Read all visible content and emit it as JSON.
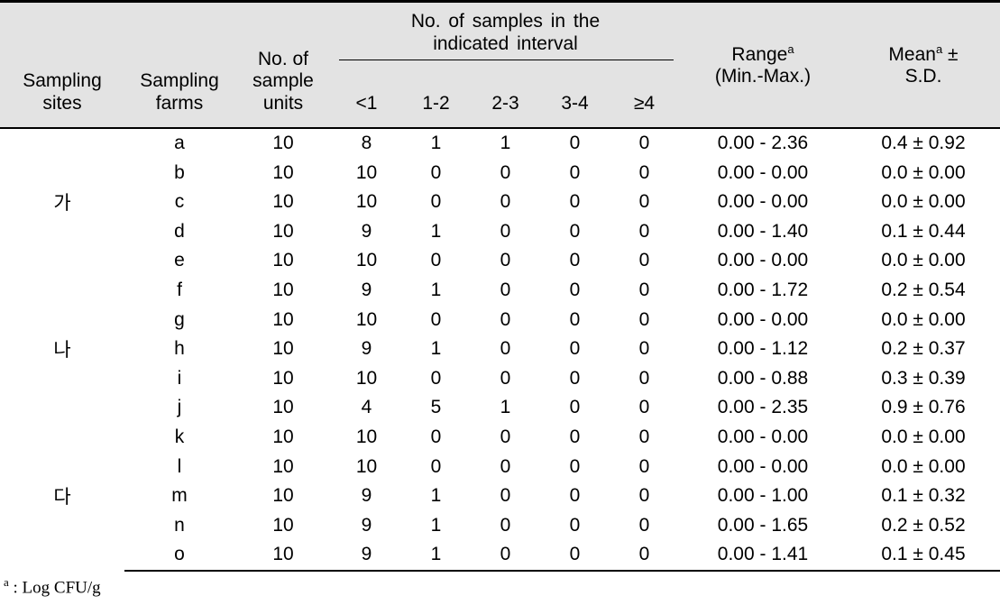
{
  "table": {
    "headers": {
      "sampling_sites": "Sampling\nsites",
      "sampling_sites_l1": "Sampling",
      "sampling_sites_l2": "sites",
      "sampling_farms_l1": "Sampling",
      "sampling_farms_l2": "farms",
      "sample_units_l1": "No. of",
      "sample_units_l2": "sample",
      "sample_units_l3": "units",
      "interval_group_l1": "No. of samples in the",
      "interval_group_l2": "indicated interval",
      "interval_bins": [
        "<1",
        "1-2",
        "2-3",
        "3-4",
        "≥4"
      ],
      "range_l1": "Range",
      "range_sup": "a",
      "range_l2": "(Min.-Max.)",
      "mean_l1": "Mean",
      "mean_sup": "a",
      "mean_pm": "±",
      "mean_l2": "S.D."
    },
    "groups": [
      {
        "site": "가",
        "site_row_index": 2,
        "rows": [
          {
            "farm": "a",
            "units": "10",
            "bins": [
              "8",
              "1",
              "1",
              "0",
              "0"
            ],
            "range": "0.00 - 2.36",
            "mean": "0.4 ± 0.92"
          },
          {
            "farm": "b",
            "units": "10",
            "bins": [
              "10",
              "0",
              "0",
              "0",
              "0"
            ],
            "range": "0.00 - 0.00",
            "mean": "0.0 ± 0.00"
          },
          {
            "farm": "c",
            "units": "10",
            "bins": [
              "10",
              "0",
              "0",
              "0",
              "0"
            ],
            "range": "0.00 - 0.00",
            "mean": "0.0 ± 0.00"
          },
          {
            "farm": "d",
            "units": "10",
            "bins": [
              "9",
              "1",
              "0",
              "0",
              "0"
            ],
            "range": "0.00 - 1.40",
            "mean": "0.1 ± 0.44"
          },
          {
            "farm": "e",
            "units": "10",
            "bins": [
              "10",
              "0",
              "0",
              "0",
              "0"
            ],
            "range": "0.00 - 0.00",
            "mean": "0.0 ± 0.00"
          },
          {
            "farm": "f",
            "units": "10",
            "bins": [
              "9",
              "1",
              "0",
              "0",
              "0"
            ],
            "range": "0.00 - 1.72",
            "mean": "0.2 ± 0.54"
          }
        ]
      },
      {
        "site": "나",
        "site_row_index": 1,
        "rows": [
          {
            "farm": "g",
            "units": "10",
            "bins": [
              "10",
              "0",
              "0",
              "0",
              "0"
            ],
            "range": "0.00 - 0.00",
            "mean": "0.0 ± 0.00"
          },
          {
            "farm": "h",
            "units": "10",
            "bins": [
              "9",
              "1",
              "0",
              "0",
              "0"
            ],
            "range": "0.00 - 1.12",
            "mean": "0.2 ± 0.37"
          },
          {
            "farm": "i",
            "units": "10",
            "bins": [
              "10",
              "0",
              "0",
              "0",
              "0"
            ],
            "range": "0.00 - 0.88",
            "mean": "0.3 ± 0.39"
          },
          {
            "farm": "j",
            "units": "10",
            "bins": [
              "4",
              "5",
              "1",
              "0",
              "0"
            ],
            "range": "0.00 - 2.35",
            "mean": "0.9 ± 0.76"
          },
          {
            "farm": "k",
            "units": "10",
            "bins": [
              "10",
              "0",
              "0",
              "0",
              "0"
            ],
            "range": "0.00 - 0.00",
            "mean": "0.0 ± 0.00"
          },
          {
            "farm": "l",
            "units": "10",
            "bins": [
              "10",
              "0",
              "0",
              "0",
              "0"
            ],
            "range": "0.00 - 0.00",
            "mean": "0.0 ± 0.00"
          }
        ]
      },
      {
        "site": "다",
        "site_row_index": 0,
        "rows": [
          {
            "farm": "m",
            "units": "10",
            "bins": [
              "9",
              "1",
              "0",
              "0",
              "0"
            ],
            "range": "0.00 - 1.00",
            "mean": "0.1 ± 0.32"
          },
          {
            "farm": "n",
            "units": "10",
            "bins": [
              "9",
              "1",
              "0",
              "0",
              "0"
            ],
            "range": "0.00 - 1.65",
            "mean": "0.2 ± 0.52"
          },
          {
            "farm": "o",
            "units": "10",
            "bins": [
              "9",
              "1",
              "0",
              "0",
              "0"
            ],
            "range": "0.00 - 1.41",
            "mean": "0.1 ± 0.45"
          }
        ]
      }
    ],
    "footnote": {
      "sup": "a",
      "text": " : Log  CFU/g"
    }
  },
  "colors": {
    "header_background": "#e3e3e3",
    "rule": "#000000",
    "text": "#000000",
    "page_background": "#ffffff"
  }
}
